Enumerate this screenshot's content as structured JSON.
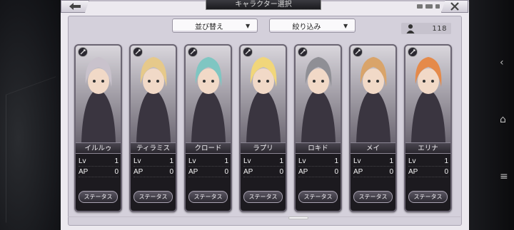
{
  "header": {
    "title": "キャラクター選択",
    "back_icon": "back-arrow-icon",
    "close_icon": "close-icon"
  },
  "toolbar": {
    "sort_label": "並び替え",
    "filter_label": "絞り込み",
    "owned_count": "118"
  },
  "characters": [
    {
      "name": "イルルゥ",
      "lv_label": "Lv",
      "lv": "1",
      "ap_label": "AP",
      "ap": "0",
      "status_label": "ステータス"
    },
    {
      "name": "ティラミス",
      "lv_label": "Lv",
      "lv": "1",
      "ap_label": "AP",
      "ap": "0",
      "status_label": "ステータス"
    },
    {
      "name": "クロード",
      "lv_label": "Lv",
      "lv": "1",
      "ap_label": "AP",
      "ap": "0",
      "status_label": "ステータス"
    },
    {
      "name": "ラプリ",
      "lv_label": "Lv",
      "lv": "1",
      "ap_label": "AP",
      "ap": "0",
      "status_label": "ステータス"
    },
    {
      "name": "ロキド",
      "lv_label": "Lv",
      "lv": "1",
      "ap_label": "AP",
      "ap": "0",
      "status_label": "ステータス"
    },
    {
      "name": "メイ",
      "lv_label": "Lv",
      "lv": "1",
      "ap_label": "AP",
      "ap": "0",
      "status_label": "ステータス"
    },
    {
      "name": "エリナ",
      "lv_label": "Lv",
      "lv": "1",
      "ap_label": "AP",
      "ap": "0",
      "status_label": "ステータス"
    }
  ],
  "colors": {
    "panel_bg": "#ece9ef",
    "card_bg": "#1c1a1f",
    "portrait_tints": [
      "#c9c2cc",
      "#e6c98a",
      "#7fc6c2",
      "#f1d67a",
      "#8f8f95",
      "#d9a46a",
      "#e58a4a"
    ]
  }
}
